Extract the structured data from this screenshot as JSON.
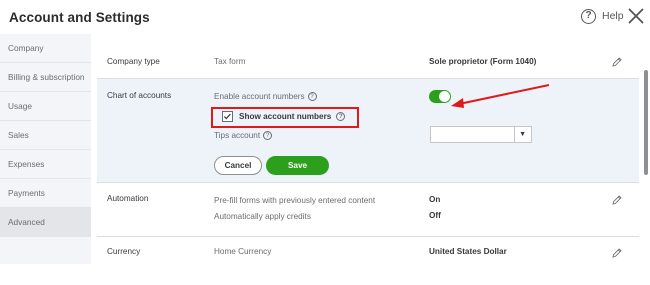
{
  "header": {
    "title": "Account and Settings",
    "help_icon_glyph": "?",
    "help_label": "Help"
  },
  "sidebar": {
    "items": [
      {
        "label": "Company"
      },
      {
        "label": "Billing & subscription"
      },
      {
        "label": "Usage"
      },
      {
        "label": "Sales"
      },
      {
        "label": "Expenses"
      },
      {
        "label": "Payments"
      },
      {
        "label": "Advanced",
        "active": true
      }
    ]
  },
  "company_type": {
    "label": "Company type",
    "field": "Tax form",
    "value": "Sole proprietor (Form 1040)"
  },
  "chart_of_accounts": {
    "label": "Chart of accounts",
    "enable_label": "Enable account numbers",
    "enable_on": true,
    "show_label": "Show account numbers",
    "show_checked": true,
    "tips_label": "Tips account",
    "tips_value": "",
    "help_glyph": "?",
    "cancel_label": "Cancel",
    "save_label": "Save"
  },
  "automation": {
    "label": "Automation",
    "prefill_label": "Pre-fill forms with previously entered content",
    "prefill_value": "On",
    "credits_label": "Automatically apply credits",
    "credits_value": "Off"
  },
  "currency": {
    "label": "Currency",
    "field": "Home Currency",
    "value": "United States Dollar"
  },
  "colors": {
    "accent_green": "#2ca01c",
    "annotation_red": "#e01a1a",
    "highlight_row": "#eef3f9"
  },
  "icons": [
    "help-icon",
    "close-icon",
    "pencil-icon",
    "question-icon",
    "checkmark-icon",
    "dropdown-arrow-icon",
    "annotation-arrow-icon"
  ]
}
